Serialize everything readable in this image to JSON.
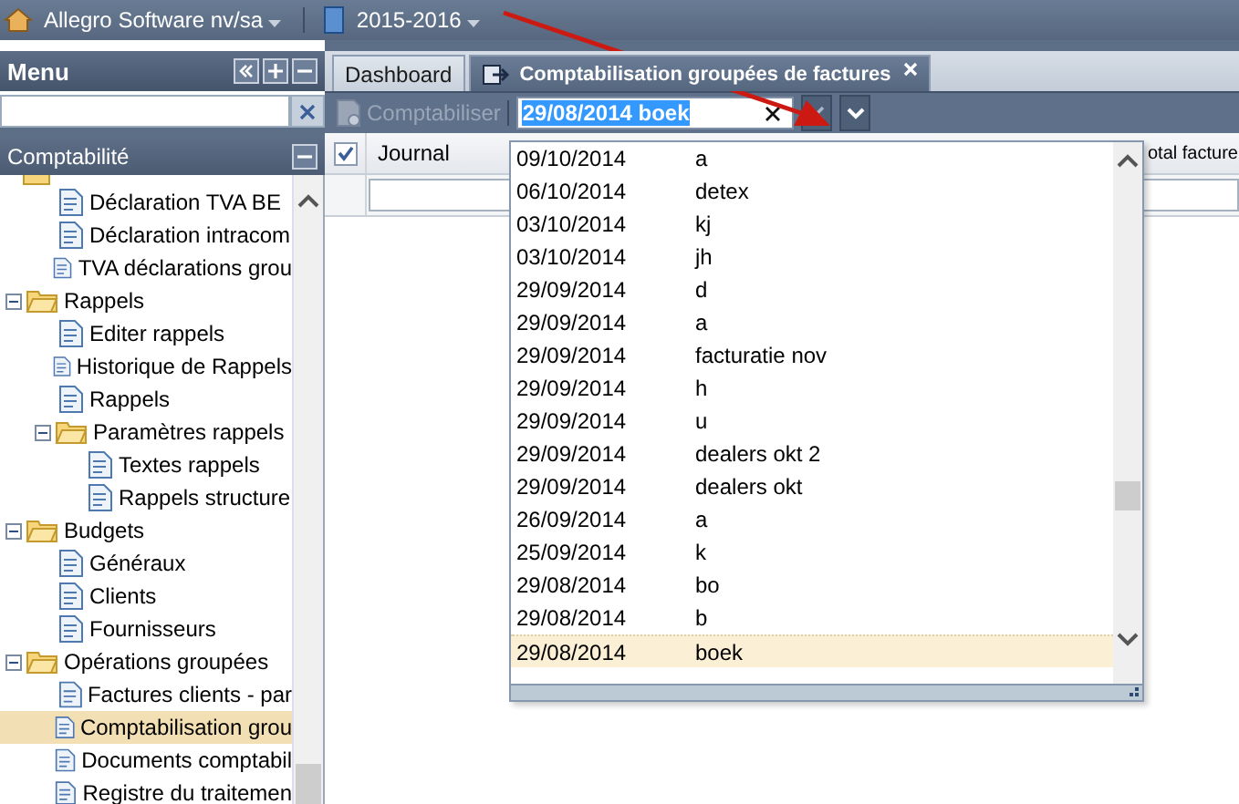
{
  "top_bar": {
    "company": "Allegro Software nv/sa",
    "year": "2015-2016"
  },
  "sidebar": {
    "title": "Menu",
    "section": "Comptabilité",
    "partial_children": [
      {
        "label": "Déclaration TVA BE",
        "selected": false
      },
      {
        "label": "Déclaration intracom",
        "selected": false
      },
      {
        "label": "TVA déclarations grou",
        "selected": false
      }
    ],
    "tree": [
      {
        "label": "Rappels",
        "expanded": true,
        "selected": false,
        "children": [
          {
            "label": "Editer rappels",
            "selected": false
          },
          {
            "label": "Historique de Rappels",
            "selected": false
          },
          {
            "label": "Rappels",
            "selected": false
          },
          {
            "label": "Paramètres rappels",
            "expanded": true,
            "selected": false,
            "children": [
              {
                "label": "Textes rappels",
                "selected": false
              },
              {
                "label": "Rappels structure",
                "selected": false
              }
            ]
          }
        ]
      },
      {
        "label": "Budgets",
        "expanded": true,
        "selected": false,
        "children": [
          {
            "label": "Généraux",
            "selected": false
          },
          {
            "label": "Clients",
            "selected": false
          },
          {
            "label": "Fournisseurs",
            "selected": false
          }
        ]
      },
      {
        "label": "Opérations groupées",
        "expanded": true,
        "selected": false,
        "children": [
          {
            "label": "Factures clients - par",
            "selected": false
          },
          {
            "label": "Comptabilisation grou",
            "selected": true
          },
          {
            "label": "Documents comptabil",
            "selected": false
          },
          {
            "label": "Registre du traitemen",
            "selected": false
          }
        ]
      }
    ]
  },
  "tabs": [
    {
      "label": "Dashboard",
      "selected": false,
      "closable": false
    },
    {
      "label": "Comptabilisation groupées de factures",
      "selected": true,
      "closable": true
    }
  ],
  "toolbar": {
    "post_button": {
      "label": "Comptabiliser",
      "disabled": true
    },
    "combo": {
      "value": "29/08/2014 boek"
    }
  },
  "grid": {
    "header_checked": true,
    "columns": [
      "Journal",
      "otal facture"
    ]
  },
  "dropdown": {
    "items": [
      {
        "date": "09/10/2014",
        "name": "a",
        "selected": false
      },
      {
        "date": "06/10/2014",
        "name": "detex",
        "selected": false
      },
      {
        "date": "03/10/2014",
        "name": "kj",
        "selected": false
      },
      {
        "date": "03/10/2014",
        "name": "jh",
        "selected": false
      },
      {
        "date": "29/09/2014",
        "name": "d",
        "selected": false
      },
      {
        "date": "29/09/2014",
        "name": "a",
        "selected": false
      },
      {
        "date": "29/09/2014",
        "name": "facturatie nov",
        "selected": false
      },
      {
        "date": "29/09/2014",
        "name": "h",
        "selected": false
      },
      {
        "date": "29/09/2014",
        "name": "u",
        "selected": false
      },
      {
        "date": "29/09/2014",
        "name": "dealers okt 2",
        "selected": false
      },
      {
        "date": "29/09/2014",
        "name": "dealers okt",
        "selected": false
      },
      {
        "date": "26/09/2014",
        "name": "a",
        "selected": false
      },
      {
        "date": "25/09/2014",
        "name": "k",
        "selected": false
      },
      {
        "date": "29/08/2014",
        "name": "bo",
        "selected": false
      },
      {
        "date": "29/08/2014",
        "name": "b",
        "selected": false
      },
      {
        "date": "29/08/2014",
        "name": "boek",
        "selected": true
      }
    ]
  }
}
